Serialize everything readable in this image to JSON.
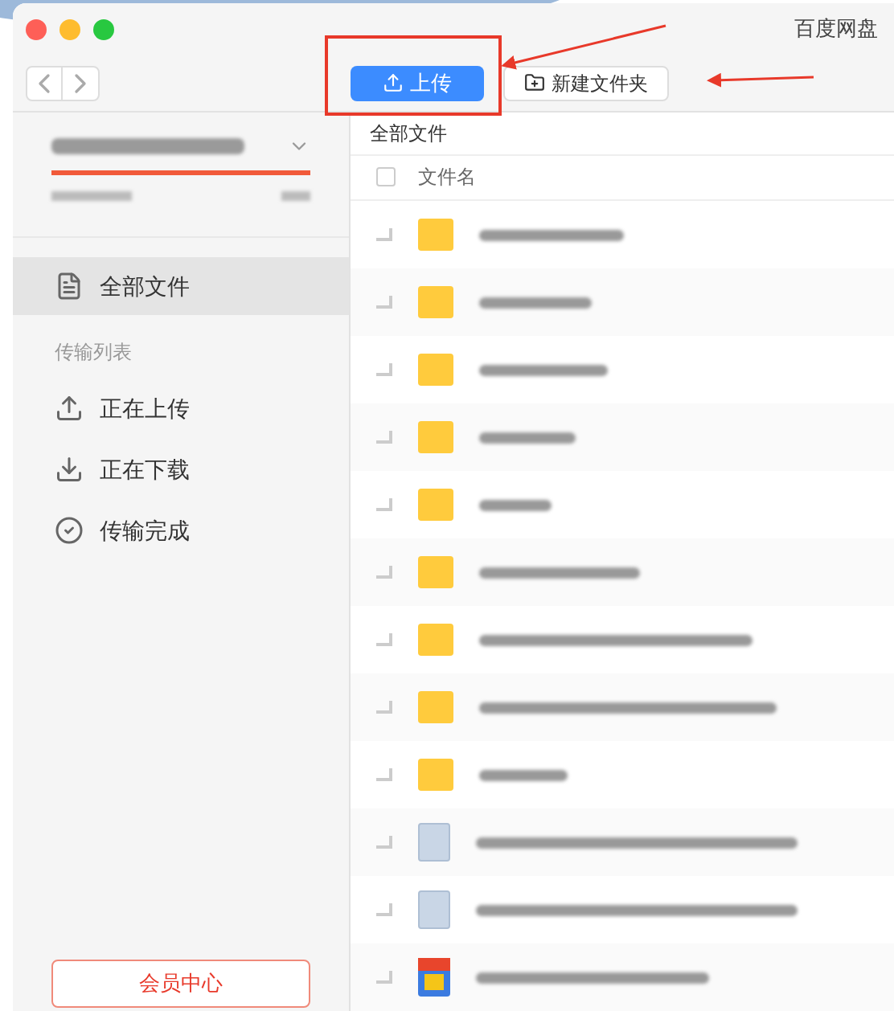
{
  "window": {
    "title": "百度网盘"
  },
  "toolbar": {
    "upload_button": "上传",
    "new_folder_button": "新建文件夹"
  },
  "sidebar": {
    "items": [
      {
        "label": "全部文件",
        "kind": "all",
        "selected": true
      }
    ],
    "section_title": "传输列表",
    "transfer_items": [
      {
        "label": "正在上传",
        "kind": "upload",
        "selected": false
      },
      {
        "label": "正在下载",
        "kind": "download",
        "selected": false
      },
      {
        "label": "传输完成",
        "kind": "done",
        "selected": false
      }
    ],
    "member_button": "会员中心"
  },
  "breadcrumb": "全部文件",
  "table": {
    "select_all_checked": false,
    "columns": [
      "文件名"
    ],
    "rows": [
      {
        "kind": "folder",
        "checked": false
      },
      {
        "kind": "folder",
        "checked": false
      },
      {
        "kind": "folder",
        "checked": false
      },
      {
        "kind": "folder",
        "checked": false
      },
      {
        "kind": "folder",
        "checked": false
      },
      {
        "kind": "folder",
        "checked": false
      },
      {
        "kind": "folder",
        "checked": false
      },
      {
        "kind": "folder",
        "checked": false
      },
      {
        "kind": "folder",
        "checked": false
      },
      {
        "kind": "document",
        "checked": false
      },
      {
        "kind": "document",
        "checked": false
      },
      {
        "kind": "image",
        "checked": false
      }
    ]
  }
}
